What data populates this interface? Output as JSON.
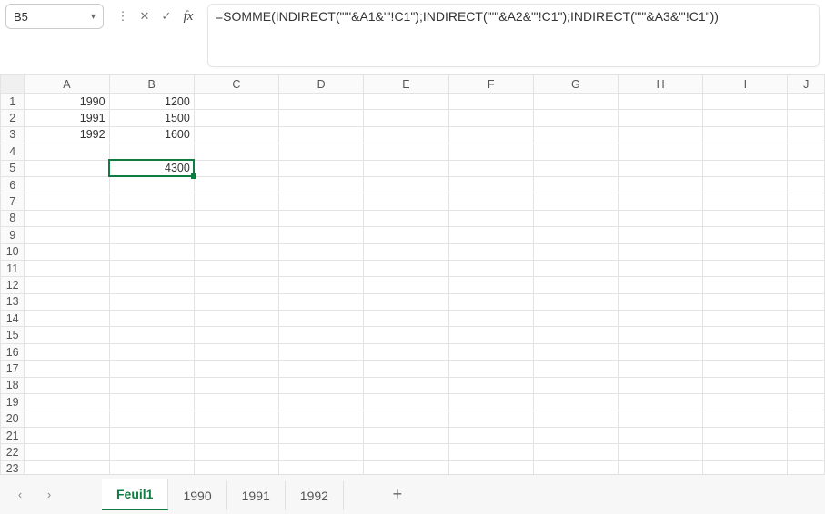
{
  "nameBox": {
    "value": "B5"
  },
  "formulaBar": {
    "formula": "=SOMME(INDIRECT(\"'\"&A1&\"'!C1\");INDIRECT(\"'\"&A2&\"'!C1\");INDIRECT(\"'\"&A3&\"'!C1\"))"
  },
  "columns": [
    "A",
    "B",
    "C",
    "D",
    "E",
    "F",
    "G",
    "H",
    "I",
    "J"
  ],
  "rowCount": 23,
  "dashedRightAfterCol": "F",
  "selection": {
    "cell": "B5"
  },
  "cells": {
    "A1": "1990",
    "B1": "1200",
    "A2": "1991",
    "B2": "1500",
    "A3": "1992",
    "B3": "1600",
    "B5": "4300"
  },
  "sheets": {
    "active": "Feuil1",
    "tabs": [
      "Feuil1",
      "1990",
      "1991",
      "1992"
    ]
  },
  "icons": {
    "chevDown": "▾",
    "dots": "⋮",
    "cancel": "✕",
    "accept": "✓",
    "fx": "fx",
    "prev": "‹",
    "next": "›",
    "add": "+"
  }
}
